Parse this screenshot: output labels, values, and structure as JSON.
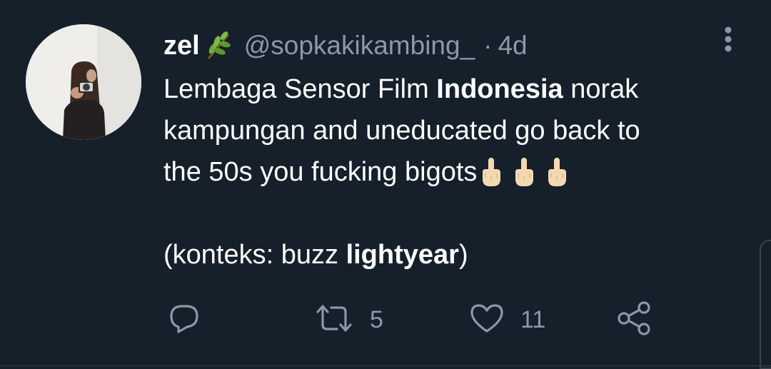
{
  "tweet": {
    "display_name": "zel",
    "name_emoji": "herb-emoji",
    "handle": "@sopkakikambing_",
    "separator": "·",
    "time": "4d",
    "body": {
      "line1_a": "Lembaga Sensor Film ",
      "line1_bold": "Indonesia",
      "line1_b": " norak",
      "line2": "kampungan and uneducated go back to",
      "line3": "the 50s you fucking bigots",
      "line4_a": "(konteks: buzz ",
      "line4_bold": "lightyear",
      "line4_b": ")"
    },
    "emojis": [
      "middle-finger-emoji",
      "middle-finger-emoji",
      "middle-finger-emoji"
    ]
  },
  "actions": {
    "reply_count": "",
    "retweet_count": "5",
    "like_count": "11"
  },
  "colors": {
    "background": "#15202b",
    "text": "#ffffff",
    "secondary": "#8b98a5",
    "border": "#38444d"
  }
}
